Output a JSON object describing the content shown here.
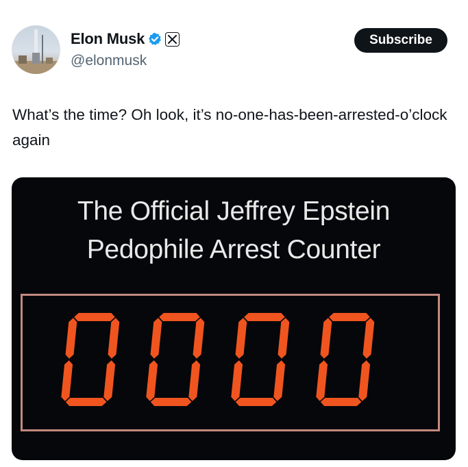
{
  "author": {
    "name": "Elon Musk",
    "handle": "@elonmusk",
    "avatar_icon": "rocket-launch-avatar",
    "verified_icon": "verified-badge-icon",
    "affiliation_icon": "x-logo-icon"
  },
  "subscribe_label": "Subscribe",
  "tweet_text": "What’s the time? Oh look, it’s no-one-has-been-arrested-o’clock again",
  "media": {
    "title_line1": "The Official Jeffrey Epstein",
    "title_line2": "Pedophile Arrest Counter",
    "counter_value": "0000"
  },
  "colors": {
    "verified_blue": "#1d9bf0",
    "digit_orange": "#f0551f",
    "button_black": "#0f1419"
  }
}
